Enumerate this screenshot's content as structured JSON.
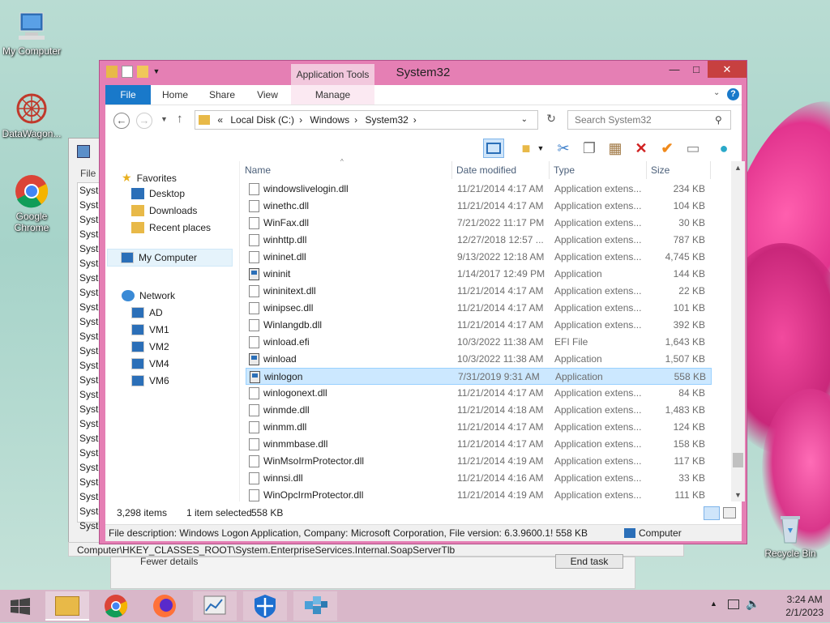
{
  "desktop": {
    "icons": [
      {
        "label": "My Computer"
      },
      {
        "label": "DataWagon..."
      },
      {
        "label": "Google Chrome"
      },
      {
        "label": "Recycle Bin"
      }
    ]
  },
  "bg_window": {
    "menu_file": "File",
    "rows": [
      "Syste",
      "Syste",
      "Syste",
      "Syste",
      "Syste",
      "Syste",
      "Syste",
      "Syste",
      "Syste",
      "Syste",
      "Syste",
      "Syste",
      "Syste",
      "Syste",
      "Syste",
      "Syste",
      "Syste",
      "Syste",
      "Syste",
      "Syste",
      "Syste",
      "Syste",
      "Syste",
      "Syste"
    ],
    "status_path": "Computer\\HKEY_CLASSES_ROOT\\System.EnterpriseServices.Internal.SoapServerTlb",
    "fewer_details": "Fewer details",
    "end_task": "End task"
  },
  "explorer": {
    "title": "System32",
    "app_tools": "Application Tools",
    "tabs": {
      "file": "File",
      "home": "Home",
      "share": "Share",
      "view": "View",
      "manage": "Manage"
    },
    "address": {
      "prefix": "«",
      "parts": [
        "Local Disk (C:)",
        "Windows",
        "System32"
      ]
    },
    "search_placeholder": "Search System32",
    "nav": {
      "favorites": "Favorites",
      "desktop": "Desktop",
      "downloads": "Downloads",
      "recent": "Recent places",
      "my_computer": "My Computer",
      "network": "Network",
      "machines": [
        "AD",
        "VM1",
        "VM2",
        "VM4",
        "VM6"
      ]
    },
    "columns": {
      "name": "Name",
      "date": "Date modified",
      "type": "Type",
      "size": "Size"
    },
    "files": [
      {
        "name": "windowslivelogin.dll",
        "date": "11/21/2014 4:17 AM",
        "type": "Application extens...",
        "size": "234 KB",
        "icon": "dll"
      },
      {
        "name": "winethc.dll",
        "date": "11/21/2014 4:17 AM",
        "type": "Application extens...",
        "size": "104 KB",
        "icon": "dll"
      },
      {
        "name": "WinFax.dll",
        "date": "7/21/2022 11:17 PM",
        "type": "Application extens...",
        "size": "30 KB",
        "icon": "dll"
      },
      {
        "name": "winhttp.dll",
        "date": "12/27/2018 12:57 ...",
        "type": "Application extens...",
        "size": "787 KB",
        "icon": "dll"
      },
      {
        "name": "wininet.dll",
        "date": "9/13/2022 12:18 AM",
        "type": "Application extens...",
        "size": "4,745 KB",
        "icon": "dll"
      },
      {
        "name": "wininit",
        "date": "1/14/2017 12:49 PM",
        "type": "Application",
        "size": "144 KB",
        "icon": "app"
      },
      {
        "name": "wininitext.dll",
        "date": "11/21/2014 4:17 AM",
        "type": "Application extens...",
        "size": "22 KB",
        "icon": "dll"
      },
      {
        "name": "winipsec.dll",
        "date": "11/21/2014 4:17 AM",
        "type": "Application extens...",
        "size": "101 KB",
        "icon": "dll"
      },
      {
        "name": "Winlangdb.dll",
        "date": "11/21/2014 4:17 AM",
        "type": "Application extens...",
        "size": "392 KB",
        "icon": "dll"
      },
      {
        "name": "winload.efi",
        "date": "10/3/2022 11:38 AM",
        "type": "EFI File",
        "size": "1,643 KB",
        "icon": "file"
      },
      {
        "name": "winload",
        "date": "10/3/2022 11:38 AM",
        "type": "Application",
        "size": "1,507 KB",
        "icon": "app"
      },
      {
        "name": "winlogon",
        "date": "7/31/2019 9:31 AM",
        "type": "Application",
        "size": "558 KB",
        "icon": "app"
      },
      {
        "name": "winlogonext.dll",
        "date": "11/21/2014 4:17 AM",
        "type": "Application extens...",
        "size": "84 KB",
        "icon": "dll"
      },
      {
        "name": "winmde.dll",
        "date": "11/21/2014 4:18 AM",
        "type": "Application extens...",
        "size": "1,483 KB",
        "icon": "dll"
      },
      {
        "name": "winmm.dll",
        "date": "11/21/2014 4:17 AM",
        "type": "Application extens...",
        "size": "124 KB",
        "icon": "dll"
      },
      {
        "name": "winmmbase.dll",
        "date": "11/21/2014 4:17 AM",
        "type": "Application extens...",
        "size": "158 KB",
        "icon": "dll"
      },
      {
        "name": "WinMsoIrmProtector.dll",
        "date": "11/21/2014 4:19 AM",
        "type": "Application extens...",
        "size": "117 KB",
        "icon": "dll"
      },
      {
        "name": "winnsi.dll",
        "date": "11/21/2014 4:16 AM",
        "type": "Application extens...",
        "size": "33 KB",
        "icon": "dll"
      },
      {
        "name": "WinOpcIrmProtector.dll",
        "date": "11/21/2014 4:19 AM",
        "type": "Application extens...",
        "size": "111 KB",
        "icon": "dll"
      }
    ],
    "selected_index": 11,
    "status": {
      "items": "3,298 items",
      "selected": "1 item selected",
      "size": "558 KB"
    },
    "details": {
      "description": "File description: Windows Logon Application, Company: Microsoft Corporation, File version: 6.3.9600.1! 558 KB",
      "location": "Computer"
    }
  },
  "taskbar": {
    "time": "3:24 AM",
    "date": "2/1/2023"
  },
  "colors": {
    "accent": "#1979ca",
    "window_frame": "#e57fb4",
    "selection": "#cce8ff"
  }
}
